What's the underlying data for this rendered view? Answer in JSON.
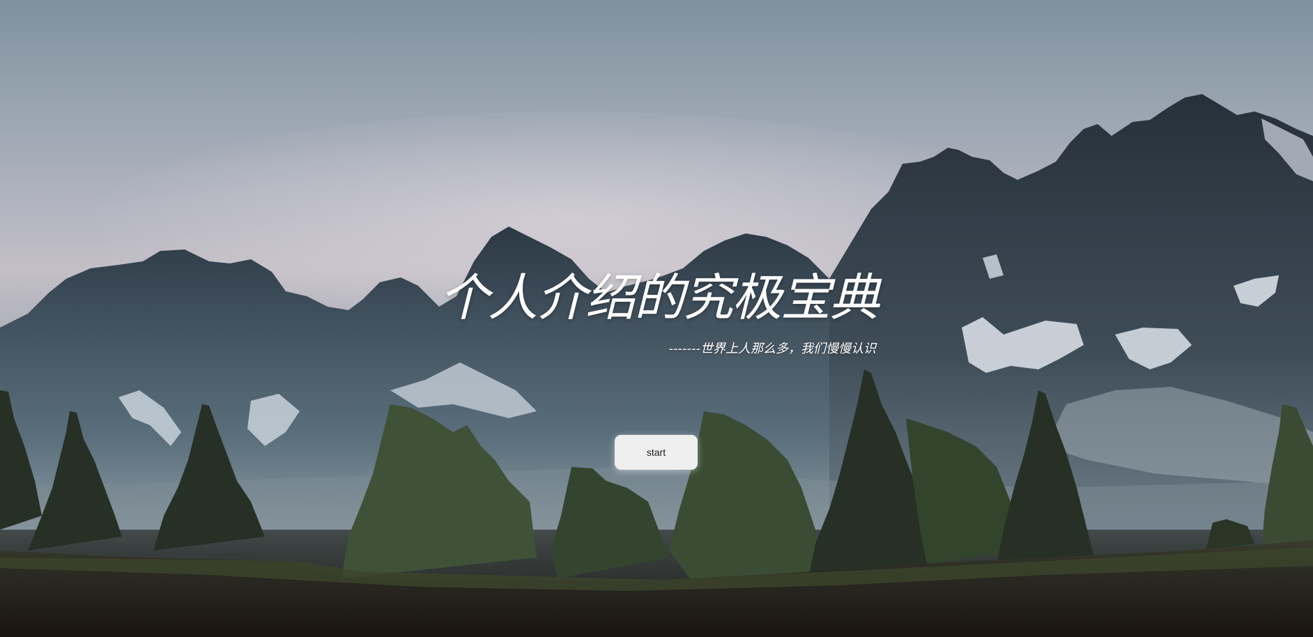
{
  "hero": {
    "headline": "个人介绍的究极宝典",
    "tagline": "-------世界上人那么多，我们慢慢认识",
    "start_label": "start",
    "background_icon": "mountain-landscape-image"
  },
  "colors": {
    "headline": "#ffffff",
    "button_bg": "#efefef",
    "button_text": "#1d1d1d"
  }
}
